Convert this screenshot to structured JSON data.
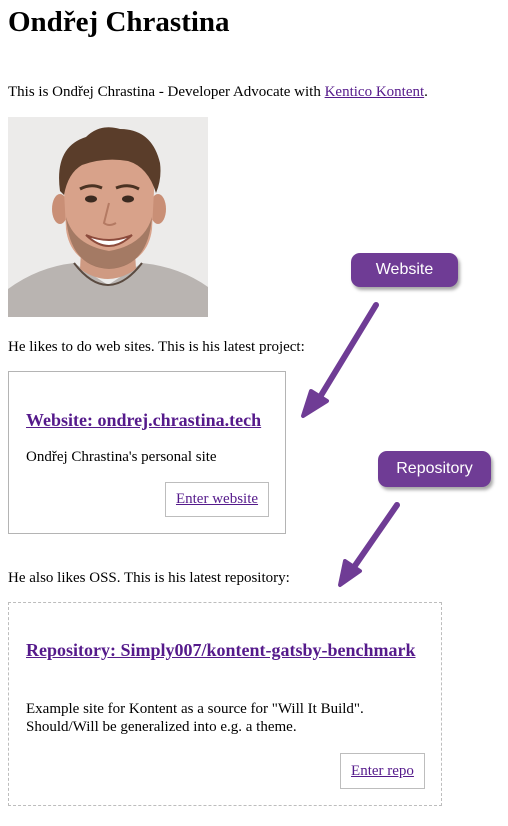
{
  "header": {
    "title": "Ondřej Chrastina"
  },
  "intro": {
    "text": "This is Ondřej Chrastina - Developer Advocate with ",
    "link_label": "Kentico Kontent",
    "suffix": "."
  },
  "projects": {
    "intro": "He likes to do web sites. This is his latest project:",
    "card": {
      "title": "Website: ondrej.chrastina.tech",
      "description": "Ondřej Chrastina's personal site",
      "button_label": "Enter website"
    }
  },
  "repositories": {
    "intro": "He also likes OSS. This is his latest repository:",
    "card": {
      "title": "Repository: Simply007/kontent-gatsby-benchmark",
      "description": "Example site for Kontent as a source for \"Will It Build\". Should/Will be generalized into e.g. a theme.",
      "button_label": "Enter repo"
    }
  },
  "annotations": {
    "website_label": "Website",
    "repository_label": "Repository",
    "color": "#6f3c95"
  }
}
